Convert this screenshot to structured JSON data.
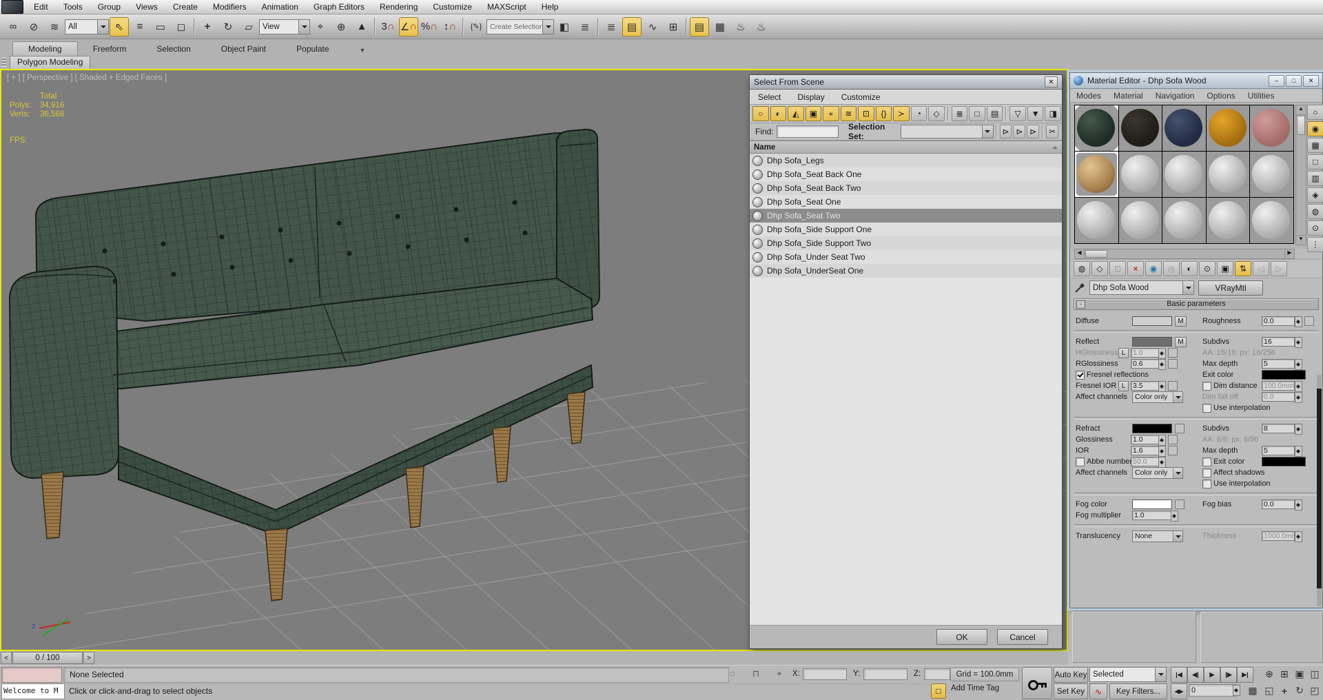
{
  "colors": {
    "accent_yellow": "#e9c75c",
    "viewport_border": "#e8e800",
    "viewport_bg": "#7d7d7d",
    "stats_text": "#d9c536",
    "selected_row": "#8c8c8c",
    "sofa_green": "#44564b",
    "leg_wood": "#9a7848",
    "swatch_row1": [
      "#2e3d33",
      "#24211d",
      "#2c3a55",
      "#c8860f",
      "#c38b8b"
    ],
    "swatch_wood": "#b08d5a",
    "swatch_gray": "#c9c9c9"
  },
  "menubar": {
    "items": [
      "Edit",
      "Tools",
      "Group",
      "Views",
      "Create",
      "Modifiers",
      "Animation",
      "Graph Editors",
      "Rendering",
      "Customize",
      "MAXScript",
      "Help"
    ]
  },
  "toolbar": {
    "filter": "All",
    "coord": "View",
    "named_sel": "Create Selection Se",
    "icons": {
      "link": "∞",
      "unlink": "⊘",
      "bind": "≋",
      "select": "⇖",
      "select_by_name": "≡",
      "rect_region": "▭",
      "window_crossing": "◻",
      "move": "+",
      "rotate": "↻",
      "scale": "▱",
      "pivot": "⌖",
      "manipulate": "⊕",
      "kbd_override": "▲",
      "snap_label": "3",
      "magnet": "∩",
      "angle": "∠",
      "percent": "%",
      "spinner_snap": "↕",
      "named_sets": "{✎}",
      "mirror": "◧",
      "align": "≣",
      "layers": "≣",
      "graphite": "▤",
      "curve_editor": "∿",
      "schematic": "⊞",
      "render_setup": "▤",
      "rendered_frame": "▦",
      "render_teapot": "♨",
      "render_quick": "♨"
    }
  },
  "ribbon": {
    "tabs": [
      "Modeling",
      "Freeform",
      "Selection",
      "Object Paint",
      "Populate"
    ],
    "overflow_icon": "▼",
    "panel": "Polygon Modeling"
  },
  "viewport": {
    "header": "[ + ] [ Perspective ] [ Shaded + Edged Faces ]",
    "stats": {
      "total_label": "Total",
      "polys_label": "Polys:",
      "polys": "34,916",
      "verts_label": "Verts:",
      "verts": "36,568",
      "fps_label": "FPS:"
    },
    "axis_z": "z"
  },
  "sfs": {
    "title": "Select From Scene",
    "close_icon": "✕",
    "menus": [
      "Select",
      "Display",
      "Customize"
    ],
    "toolbar_icons": [
      "○",
      "◐",
      "◭",
      "▣",
      "⌖",
      "≋",
      "⊡",
      "{}",
      "≻",
      "◔",
      "◇"
    ],
    "display_icons": [
      "≣",
      "□",
      "▤"
    ],
    "filter_icons": [
      "▽",
      "▼",
      "◨"
    ],
    "find_label": "Find:",
    "selection_set_label": "Selection Set:",
    "find_btns": [
      "⊳",
      "⊳",
      "⊳",
      "✂"
    ],
    "name_header": "Name",
    "items": [
      "Dhp Sofa_Legs",
      "Dhp Sofa_Seat Back One",
      "Dhp Sofa_Seat Back Two",
      "Dhp Sofa_Seat One",
      "Dhp Sofa_Seat Two",
      "Dhp Sofa_Side Support One",
      "Dhp Sofa_Side Support Two",
      "Dhp Sofa_Under Seat Two",
      "Dhp Sofa_UnderSeat One"
    ],
    "selected_item": "Dhp Sofa_Seat Two",
    "ok": "OK",
    "cancel": "Cancel"
  },
  "me": {
    "title": "Material Editor - Dhp Sofa Wood",
    "win_btns": [
      "–",
      "□",
      "✕"
    ],
    "menus": [
      "Modes",
      "Material",
      "Navigation",
      "Options",
      "Utilities"
    ],
    "side_icons": [
      "○",
      "◉",
      "▦",
      "□",
      "▥",
      "◈",
      "◍",
      "⊙",
      "⋮"
    ],
    "toolbar_icons": [
      "◍",
      "◇",
      "⊡",
      "×",
      "◉",
      "◎",
      "◐",
      "⊙",
      "▣",
      "⇅",
      "◁",
      "▷"
    ],
    "material_name": "Dhp Sofa Wood",
    "material_type": "VRayMtl",
    "rollout": "Basic parameters",
    "rollout_minus": "-",
    "params": {
      "diffuse": "Diffuse",
      "m": "M",
      "l": "L",
      "roughness": "Roughness",
      "roughness_v": "0.0",
      "reflect": "Reflect",
      "subdivs": "Subdivs",
      "subdivs_v": "16",
      "hglossiness": "HGlossiness",
      "hglossiness_v": "1.0",
      "aa_reflect": "AA: 16/16; px: 16/256",
      "rglossiness": "RGlossiness",
      "rglossiness_v": "0.6",
      "max_depth": "Max depth",
      "max_depth_v": "5",
      "fresnel": "Fresnel reflections",
      "exit_color": "Exit color",
      "fresnel_ior": "Fresnel IOR",
      "fresnel_ior_v": "3.5",
      "dim_distance": "Dim distance",
      "dim_distance_v": "100.0mm",
      "affect_channels": "Affect channels",
      "color_only": "Color only",
      "dim_fall_off": "Dim fall off",
      "dim_fall_off_v": "0.0",
      "use_interp": "Use interpolation",
      "refract": "Refract",
      "r_subdivs_v": "8",
      "glossiness": "Glossiness",
      "glossiness_v": "1.0",
      "aa_refract": "AA: 6/6; px: 6/96",
      "ior": "IOR",
      "ior_v": "1.6",
      "r_max_depth_v": "5",
      "abbe": "Abbe number",
      "abbe_v": "50.0",
      "affect_shadows": "Affect shadows",
      "fog_color": "Fog color",
      "fog_bias": "Fog bias",
      "fog_bias_v": "0.0",
      "fog_mult": "Fog multiplier",
      "fog_mult_v": "1.0",
      "translucency": "Translucency",
      "translucency_v": "None",
      "thickness": "Thickness",
      "thickness_v": "1000.0mm"
    }
  },
  "status": {
    "time_slider": "0 / 100",
    "ts_left": "<",
    "ts_right": ">",
    "listener_text": "Welcome to M",
    "selection": "None Selected",
    "prompt": "Click or click-and-drag to select objects",
    "x_label": "X:",
    "y_label": "Y:",
    "z_label": "Z:",
    "grid": "Grid = 100.0mm",
    "add_time_tag": "Add Time Tag",
    "iso_cube_icon": "□",
    "auto_key": "Auto Key",
    "set_key": "Set Key",
    "selected_dd": "Selected",
    "key_filters": "Key Filters...",
    "curve_icon": "∿",
    "frame": "0",
    "playback": [
      "|◀",
      "◀|",
      "▶",
      "|▶",
      "▶|"
    ],
    "frame_back_icon": "◀▶",
    "nav_row1": [
      "⊕",
      "⊞",
      "▣",
      "◫"
    ],
    "nav_row2": [
      "▦",
      "◱",
      "+",
      "↻",
      "◰"
    ]
  }
}
